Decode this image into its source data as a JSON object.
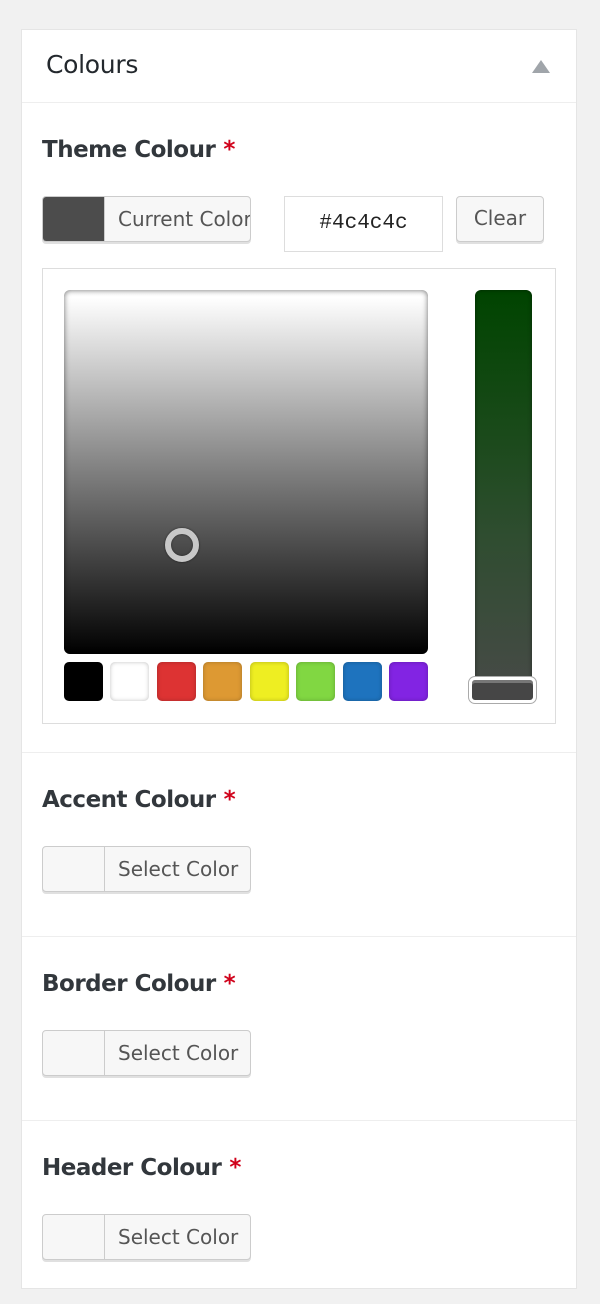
{
  "panel": {
    "title": "Colours",
    "toggle_icon": "triangle-up-icon"
  },
  "fields": [
    {
      "label": "Theme Colour",
      "required_mark": "*",
      "button_label": "Current Color",
      "current_color": "#4c4c4c",
      "hex_value": "#4c4c4c",
      "clear_label": "Clear",
      "expanded": true
    },
    {
      "label": "Accent Colour",
      "required_mark": "*",
      "button_label": "Select Color",
      "current_color": ""
    },
    {
      "label": "Border Colour",
      "required_mark": "*",
      "button_label": "Select Color",
      "current_color": ""
    },
    {
      "label": "Header Colour",
      "required_mark": "*",
      "button_label": "Select Color",
      "current_color": ""
    }
  ],
  "palette": [
    {
      "name": "black",
      "color": "#000000"
    },
    {
      "name": "white",
      "color": "#ffffff"
    },
    {
      "name": "red",
      "color": "#dd3333"
    },
    {
      "name": "orange",
      "color": "#dd9933"
    },
    {
      "name": "yellow",
      "color": "#eeee22"
    },
    {
      "name": "green",
      "color": "#81d742"
    },
    {
      "name": "blue",
      "color": "#1e73be"
    },
    {
      "name": "purple",
      "color": "#8224e3"
    }
  ],
  "picker": {
    "hue_color": "#004400",
    "strip_value_percent": 100
  }
}
